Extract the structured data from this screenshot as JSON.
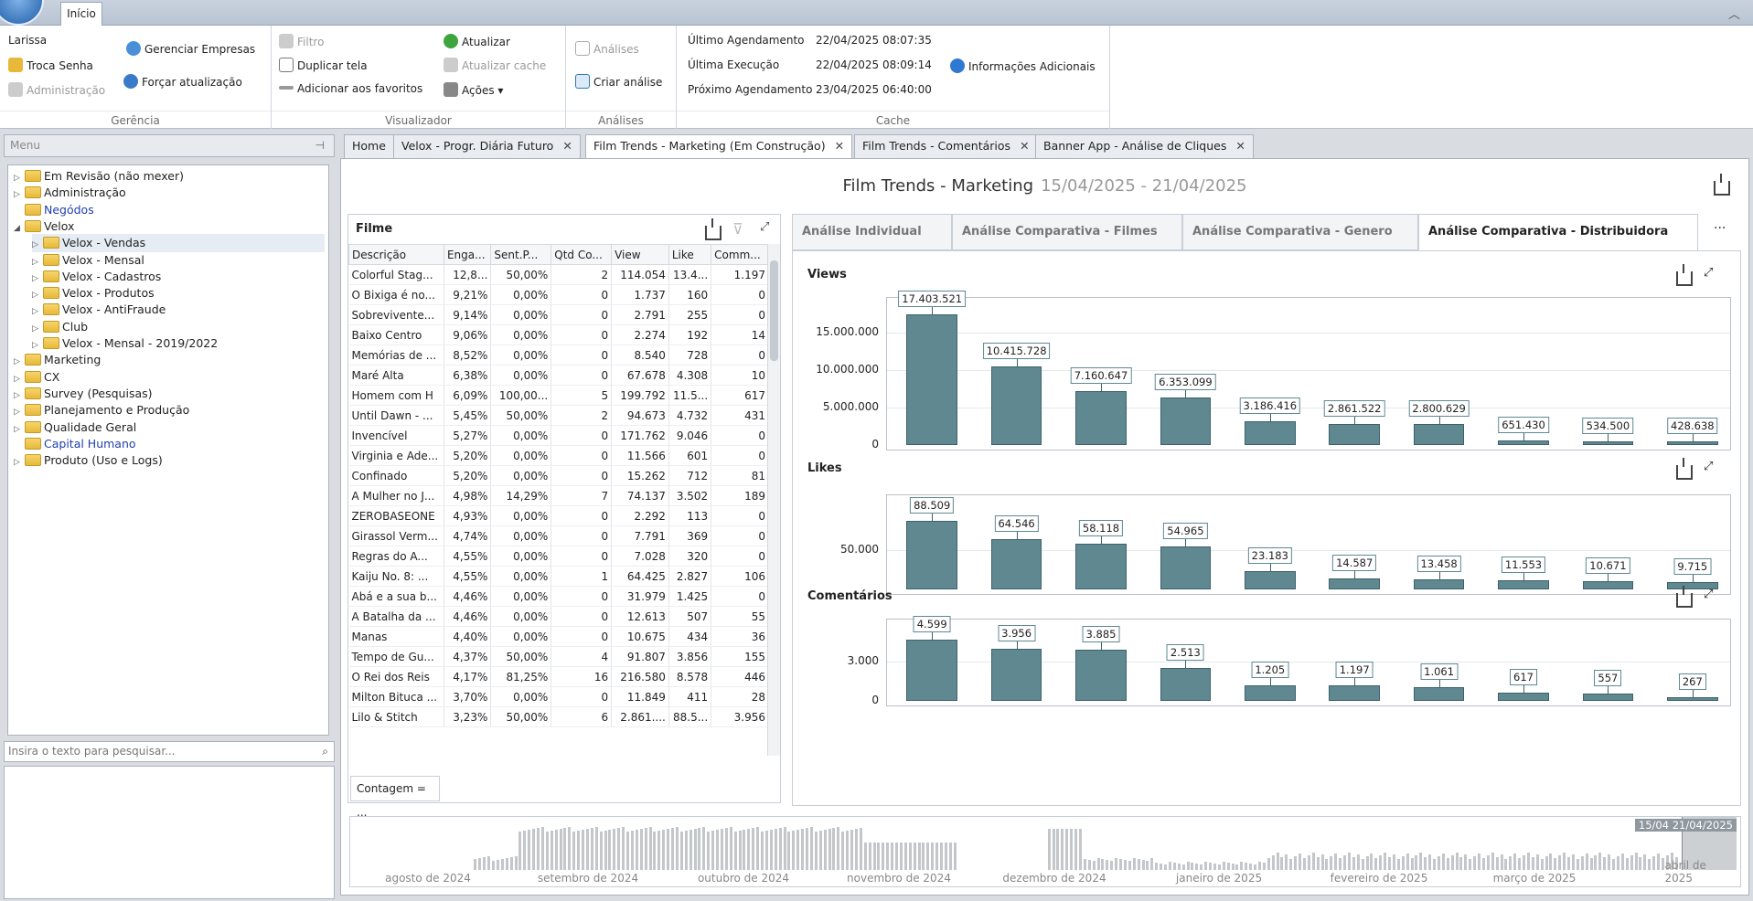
{
  "ribbon": {
    "tab": "Início",
    "gerencia": {
      "user": "Larissa",
      "troca_senha": "Troca Senha",
      "administracao": "Administração",
      "gerenciar_empresas": "Gerenciar Empresas",
      "forcar_atualizacao": "Forçar atualização",
      "label": "Gerência"
    },
    "visualizador": {
      "filtro": "Filtro",
      "duplicar_tela": "Duplicar tela",
      "adicionar_favoritos": "Adicionar aos favoritos",
      "atualizar": "Atualizar",
      "atualizar_cache": "Atualizar cache",
      "acoes": "Ações ▾",
      "label": "Visualizador"
    },
    "analises": {
      "analises": "Análises",
      "criar_analise": "Criar análise",
      "label": "Análises"
    },
    "cache": {
      "ultimo_agendamento_lbl": "Último Agendamento",
      "ultimo_agendamento_val": "22/04/2025 08:07:35",
      "ultima_execucao_lbl": "Última Execução",
      "ultima_execucao_val": "22/04/2025 08:09:14",
      "proximo_agendamento_lbl": "Próximo Agendamento",
      "proximo_agendamento_val": "23/04/2025 06:40:00",
      "info": "Informações Adicionais",
      "label": "Cache"
    }
  },
  "menu": {
    "title": "Menu",
    "search_placeholder": "Insira o texto para pesquisar...",
    "items": [
      {
        "label": "Em Revisão (não mexer)"
      },
      {
        "label": "Administração"
      },
      {
        "label": "Negódos"
      },
      {
        "label": "Velox"
      },
      {
        "label": "Velox - Vendas"
      },
      {
        "label": "Velox - Mensal"
      },
      {
        "label": "Velox - Cadastros"
      },
      {
        "label": "Velox - Produtos"
      },
      {
        "label": "Velox - AntiFraude"
      },
      {
        "label": "Club"
      },
      {
        "label": "Velox - Mensal - 2019/2022"
      },
      {
        "label": "Marketing"
      },
      {
        "label": "CX"
      },
      {
        "label": "Survey (Pesquisas)"
      },
      {
        "label": "Planejamento e Produção"
      },
      {
        "label": "Qualidade Geral"
      },
      {
        "label": "Capital Humano"
      },
      {
        "label": "Produto (Uso e Logs)"
      }
    ]
  },
  "doc_tabs": [
    {
      "label": "Home"
    },
    {
      "label": "Velox - Progr. Diária Futuro"
    },
    {
      "label": "Film Trends - Marketing (Em Construção)"
    },
    {
      "label": "Film Trends - Comentários"
    },
    {
      "label": "Banner App - Análise de Cliques"
    }
  ],
  "dashboard": {
    "title": "Film Trends - Marketing",
    "date_range": "15/04/2025 - 21/04/2025"
  },
  "grid": {
    "title": "Filme",
    "columns": [
      "Descrição",
      "Enga...",
      "Sent.P...",
      "Qtd Co...",
      "View",
      "Like",
      "Comm..."
    ],
    "rows": [
      [
        "Colorful Stag...",
        "12,8...",
        "50,00%",
        "2",
        "114.054",
        "13.4...",
        "1.197"
      ],
      [
        "O Bixiga é no...",
        "9,21%",
        "0,00%",
        "0",
        "1.737",
        "160",
        "0"
      ],
      [
        "Sobrevivente...",
        "9,14%",
        "0,00%",
        "0",
        "2.791",
        "255",
        "0"
      ],
      [
        "Baixo Centro",
        "9,06%",
        "0,00%",
        "0",
        "2.274",
        "192",
        "14"
      ],
      [
        "Memórias de ...",
        "8,52%",
        "0,00%",
        "0",
        "8.540",
        "728",
        "0"
      ],
      [
        "Maré Alta",
        "6,38%",
        "0,00%",
        "0",
        "67.678",
        "4.308",
        "10"
      ],
      [
        "Homem com H",
        "6,09%",
        "100,00...",
        "5",
        "199.792",
        "11.5...",
        "617"
      ],
      [
        "Until Dawn - ...",
        "5,45%",
        "50,00%",
        "2",
        "94.673",
        "4.732",
        "431"
      ],
      [
        "Invencível",
        "5,27%",
        "0,00%",
        "0",
        "171.762",
        "9.046",
        "0"
      ],
      [
        "Virginia e Ade...",
        "5,20%",
        "0,00%",
        "0",
        "11.566",
        "601",
        "0"
      ],
      [
        "Confinado",
        "5,20%",
        "0,00%",
        "0",
        "15.262",
        "712",
        "81"
      ],
      [
        "A Mulher no J...",
        "4,98%",
        "14,29%",
        "7",
        "74.137",
        "3.502",
        "189"
      ],
      [
        "ZEROBASEONE",
        "4,93%",
        "0,00%",
        "0",
        "2.292",
        "113",
        "0"
      ],
      [
        "Girassol Verm...",
        "4,74%",
        "0,00%",
        "0",
        "7.791",
        "369",
        "0"
      ],
      [
        "Regras do A...",
        "4,55%",
        "0,00%",
        "0",
        "7.028",
        "320",
        "0"
      ],
      [
        "Kaiju No. 8: ...",
        "4,55%",
        "0,00%",
        "1",
        "64.425",
        "2.827",
        "106"
      ],
      [
        "Abá e a sua b...",
        "4,46%",
        "0,00%",
        "0",
        "31.979",
        "1.425",
        "0"
      ],
      [
        "A Batalha da ...",
        "4,46%",
        "0,00%",
        "0",
        "12.613",
        "507",
        "55"
      ],
      [
        "Manas",
        "4,40%",
        "0,00%",
        "0",
        "10.675",
        "434",
        "36"
      ],
      [
        "Tempo de Gu...",
        "4,37%",
        "50,00%",
        "4",
        "91.807",
        "3.856",
        "155"
      ],
      [
        "O Rei dos Reis",
        "4,17%",
        "81,25%",
        "16",
        "216.580",
        "8.578",
        "446"
      ],
      [
        "Milton Bituca ...",
        "3,70%",
        "0,00%",
        "0",
        "11.849",
        "411",
        "28"
      ],
      [
        "Lilo & Stitch",
        "3,23%",
        "50,00%",
        "6",
        "2.861....",
        "88.5...",
        "3.956"
      ]
    ],
    "footer": "Contagem = ..."
  },
  "chart_tabs": [
    {
      "label": "Análise Individual"
    },
    {
      "label": "Análise Comparativa - Filmes"
    },
    {
      "label": "Análise Comparativa - Genero"
    },
    {
      "label": "Análise Comparativa - Distribuidora"
    }
  ],
  "chart_data": [
    {
      "type": "bar",
      "title": "Views",
      "values": [
        17403521,
        10415728,
        7160647,
        6353099,
        3186416,
        2861522,
        2800629,
        651430,
        534500,
        428638
      ],
      "labels": [
        "17.403.521",
        "10.415.728",
        "7.160.647",
        "6.353.099",
        "3.186.416",
        "2.861.522",
        "2.800.629",
        "651.430",
        "534.500",
        "428.638"
      ],
      "yticks": [
        {
          "v": 0,
          "t": "0"
        },
        {
          "v": 5000000,
          "t": "5.000.000"
        },
        {
          "v": 10000000,
          "t": "10.000.000"
        },
        {
          "v": 15000000,
          "t": "15.000.000"
        }
      ],
      "ylim": [
        0,
        19000000
      ]
    },
    {
      "type": "bar",
      "title": "Likes",
      "values": [
        88509,
        64546,
        58118,
        54965,
        23183,
        14587,
        13458,
        11553,
        10671,
        9715
      ],
      "labels": [
        "88.509",
        "64.546",
        "58.118",
        "54.965",
        "23.183",
        "14.587",
        "13.458",
        "11.553",
        "10.671",
        "9.715"
      ],
      "yticks": [
        {
          "v": 50000,
          "t": "50.000"
        }
      ],
      "ylim": [
        0,
        115000
      ]
    },
    {
      "type": "bar",
      "title": "Comentários",
      "values": [
        4599,
        3956,
        3885,
        2513,
        1205,
        1197,
        1061,
        617,
        557,
        267
      ],
      "labels": [
        "4.599",
        "3.956",
        "3.885",
        "2.513",
        "1.205",
        "1.197",
        "1.061",
        "617",
        "557",
        "267"
      ],
      "yticks": [
        {
          "v": 0,
          "t": "0"
        },
        {
          "v": 3000,
          "t": "3.000"
        }
      ],
      "ylim": [
        0,
        5800
      ]
    }
  ],
  "timeline": {
    "months": [
      "agosto de 2024",
      "setembro de 2024",
      "outubro de 2024",
      "novembro de 2024",
      "dezembro de 2024",
      "janeiro de 2025",
      "fevereiro de 2025",
      "março de 2025",
      "abril de 2025"
    ],
    "range": "15/04 21/04/2025"
  },
  "colors": {
    "bar": "#5f8891",
    "accent": "#1e5ca8"
  }
}
